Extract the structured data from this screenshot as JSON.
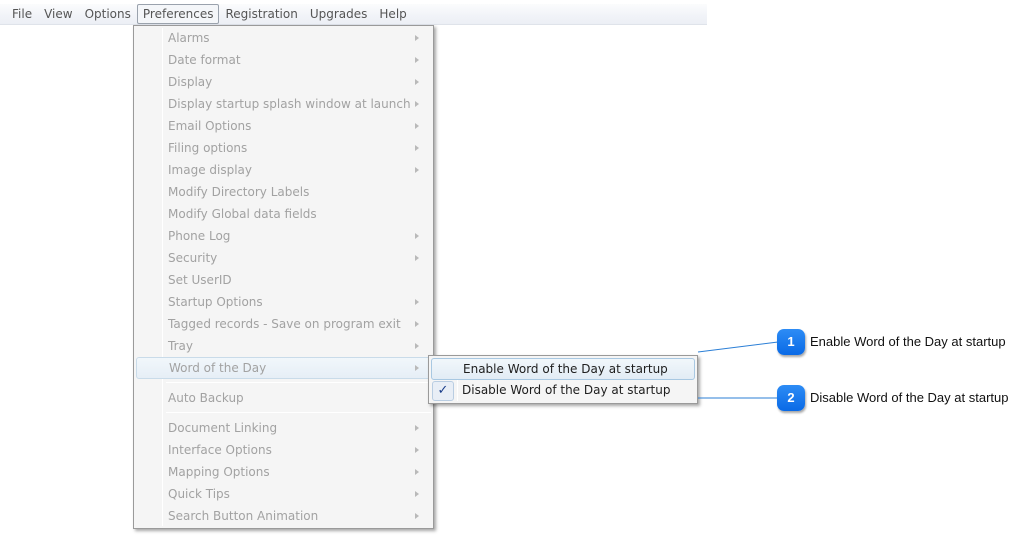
{
  "menubar": {
    "items": [
      "File",
      "View",
      "Options",
      "Preferences",
      "Registration",
      "Upgrades",
      "Help"
    ],
    "active": "Preferences"
  },
  "preferences_menu": {
    "items": [
      {
        "label": "Alarms",
        "submenu": true
      },
      {
        "label": "Date format",
        "submenu": true
      },
      {
        "label": "Display",
        "submenu": true
      },
      {
        "label": "Display startup splash window at launch",
        "submenu": true
      },
      {
        "label": "Email Options",
        "submenu": true
      },
      {
        "label": "Filing options",
        "submenu": true
      },
      {
        "label": "Image display",
        "submenu": true
      },
      {
        "label": "Modify Directory Labels",
        "submenu": false
      },
      {
        "label": "Modify Global data fields",
        "submenu": false
      },
      {
        "label": "Phone Log",
        "submenu": true
      },
      {
        "label": "Security",
        "submenu": true
      },
      {
        "label": "Set UserID",
        "submenu": false
      },
      {
        "label": "Startup Options",
        "submenu": true
      },
      {
        "label": "Tagged records - Save on program exit",
        "submenu": true
      },
      {
        "label": "Tray",
        "submenu": true
      },
      {
        "label": "Word of the Day",
        "submenu": true,
        "highlighted": true
      },
      {
        "label": "Auto Backup",
        "submenu": false
      },
      {
        "label": "Document Linking",
        "submenu": true
      },
      {
        "label": "Interface Options",
        "submenu": true
      },
      {
        "label": "Mapping Options",
        "submenu": true
      },
      {
        "label": "Quick Tips",
        "submenu": true
      },
      {
        "label": "Search Button Animation",
        "submenu": true
      }
    ]
  },
  "word_of_day_submenu": {
    "items": [
      {
        "label": "Enable Word of the Day at startup",
        "checked": false,
        "highlighted": true
      },
      {
        "label": "Disable Word of the Day at startup",
        "checked": true
      }
    ],
    "check_glyph": "✓"
  },
  "callouts": [
    {
      "number": "1",
      "text": "Enable Word of the Day at startup"
    },
    {
      "number": "2",
      "text": "Disable Word of the Day at startup"
    }
  ]
}
